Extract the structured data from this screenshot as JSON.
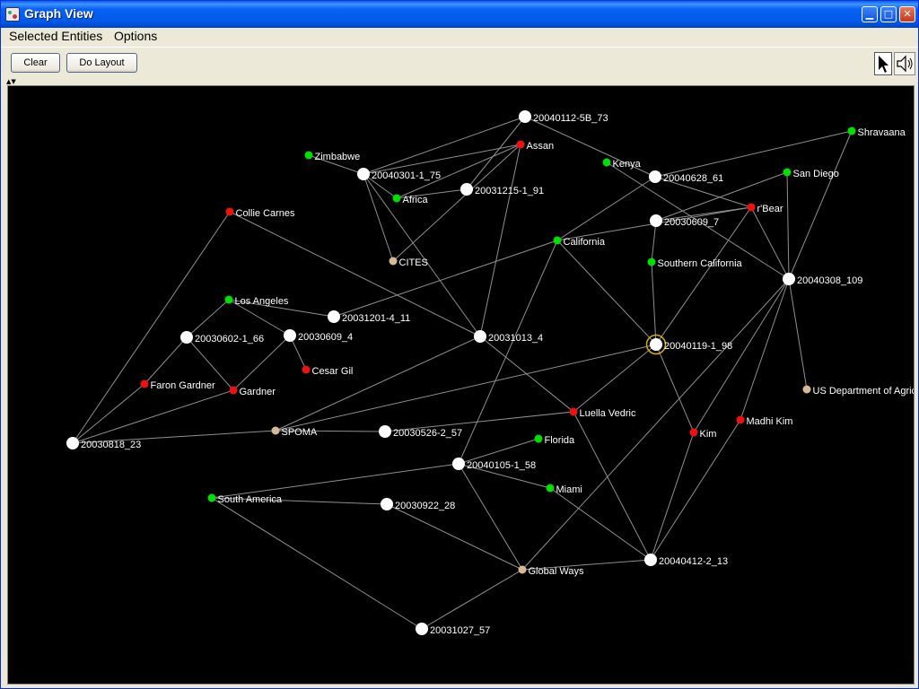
{
  "window": {
    "title": "Graph View"
  },
  "menu": {
    "items": [
      "Selected Entities",
      "Options"
    ]
  },
  "toolbar": {
    "clear_label": "Clear",
    "layout_label": "Do Layout"
  },
  "colors": {
    "event": "#ffffff",
    "place": "#00e000",
    "person": "#ee1111",
    "organization": "#d8b896",
    "edge": "#8f8f8f",
    "selection": "#d4b000"
  },
  "graph": {
    "nodes": [
      {
        "id": "n1",
        "label": "20040112-5B_73",
        "kind": "event"
      },
      {
        "id": "n2",
        "label": "Assan",
        "kind": "person"
      },
      {
        "id": "n3",
        "label": "Kenya",
        "kind": "place"
      },
      {
        "id": "n4",
        "label": "Shravaana",
        "kind": "place"
      },
      {
        "id": "n5",
        "label": "Zimbabwe",
        "kind": "place"
      },
      {
        "id": "n6",
        "label": "20040301-1_75",
        "kind": "event"
      },
      {
        "id": "n7",
        "label": "Africa",
        "kind": "place"
      },
      {
        "id": "n8",
        "label": "20031215-1_91",
        "kind": "event"
      },
      {
        "id": "n9",
        "label": "20040628_61",
        "kind": "event"
      },
      {
        "id": "n10",
        "label": "San Diego",
        "kind": "place"
      },
      {
        "id": "n11",
        "label": "Collie Carnes",
        "kind": "person"
      },
      {
        "id": "n12",
        "label": "r'Bear",
        "kind": "person"
      },
      {
        "id": "n13",
        "label": "20030609_7",
        "kind": "event"
      },
      {
        "id": "n14",
        "label": "California",
        "kind": "place"
      },
      {
        "id": "n15",
        "label": "CITES",
        "kind": "organization"
      },
      {
        "id": "n16",
        "label": "Southern California",
        "kind": "place"
      },
      {
        "id": "n17",
        "label": "20040308_109",
        "kind": "event"
      },
      {
        "id": "n18",
        "label": "Los Angeles",
        "kind": "place"
      },
      {
        "id": "n19",
        "label": "20031201-4_11",
        "kind": "event"
      },
      {
        "id": "n20",
        "label": "20030602-1_66",
        "kind": "event"
      },
      {
        "id": "n21",
        "label": "20030609_4",
        "kind": "event"
      },
      {
        "id": "n22",
        "label": "20031013_4",
        "kind": "event"
      },
      {
        "id": "n23",
        "label": "20040119-1_98",
        "kind": "event",
        "selected": true
      },
      {
        "id": "n24",
        "label": "Cesar Gil",
        "kind": "person"
      },
      {
        "id": "n25",
        "label": "Faron Gardner",
        "kind": "person"
      },
      {
        "id": "n26",
        "label": "Gardner",
        "kind": "person"
      },
      {
        "id": "n27",
        "label": "US Department of Agric",
        "kind": "organization"
      },
      {
        "id": "n28",
        "label": "Luella Vedric",
        "kind": "person"
      },
      {
        "id": "n29",
        "label": "Madhi Kim",
        "kind": "person"
      },
      {
        "id": "n30",
        "label": "Kim",
        "kind": "person"
      },
      {
        "id": "n31",
        "label": "20030818_23",
        "kind": "event"
      },
      {
        "id": "n32",
        "label": "SPOMA",
        "kind": "organization"
      },
      {
        "id": "n33",
        "label": "20030526-2_57",
        "kind": "event"
      },
      {
        "id": "n34",
        "label": "Florida",
        "kind": "place"
      },
      {
        "id": "n35",
        "label": "20040105-1_58",
        "kind": "event"
      },
      {
        "id": "n36",
        "label": "Miami",
        "kind": "place"
      },
      {
        "id": "n37",
        "label": "South America",
        "kind": "place"
      },
      {
        "id": "n38",
        "label": "20030922_28",
        "kind": "event"
      },
      {
        "id": "n39",
        "label": "Global Ways",
        "kind": "organization"
      },
      {
        "id": "n40",
        "label": "20040412-2_13",
        "kind": "event"
      },
      {
        "id": "n41",
        "label": "20031027_57",
        "kind": "event"
      }
    ],
    "edges": [
      [
        "n1",
        "n6"
      ],
      [
        "n1",
        "n8"
      ],
      [
        "n1",
        "n9"
      ],
      [
        "n2",
        "n6"
      ],
      [
        "n2",
        "n7"
      ],
      [
        "n2",
        "n22"
      ],
      [
        "n2",
        "n15"
      ],
      [
        "n3",
        "n17"
      ],
      [
        "n4",
        "n9"
      ],
      [
        "n4",
        "n17"
      ],
      [
        "n5",
        "n6"
      ],
      [
        "n6",
        "n7"
      ],
      [
        "n6",
        "n15"
      ],
      [
        "n6",
        "n22"
      ],
      [
        "n7",
        "n8"
      ],
      [
        "n9",
        "n12"
      ],
      [
        "n10",
        "n13"
      ],
      [
        "n10",
        "n17"
      ],
      [
        "n11",
        "n22"
      ],
      [
        "n11",
        "n31"
      ],
      [
        "n12",
        "n13"
      ],
      [
        "n12",
        "n14"
      ],
      [
        "n12",
        "n17"
      ],
      [
        "n12",
        "n23"
      ],
      [
        "n13",
        "n16"
      ],
      [
        "n14",
        "n19"
      ],
      [
        "n14",
        "n23"
      ],
      [
        "n14",
        "n9"
      ],
      [
        "n14",
        "n35"
      ],
      [
        "n16",
        "n23"
      ],
      [
        "n17",
        "n27"
      ],
      [
        "n17",
        "n30"
      ],
      [
        "n17",
        "n29"
      ],
      [
        "n17",
        "n39"
      ],
      [
        "n18",
        "n19"
      ],
      [
        "n18",
        "n20"
      ],
      [
        "n18",
        "n21"
      ],
      [
        "n20",
        "n26"
      ],
      [
        "n20",
        "n25"
      ],
      [
        "n21",
        "n24"
      ],
      [
        "n21",
        "n26"
      ],
      [
        "n22",
        "n28"
      ],
      [
        "n22",
        "n32"
      ],
      [
        "n23",
        "n28"
      ],
      [
        "n23",
        "n32"
      ],
      [
        "n23",
        "n30"
      ],
      [
        "n25",
        "n31"
      ],
      [
        "n26",
        "n31"
      ],
      [
        "n28",
        "n33"
      ],
      [
        "n28",
        "n40"
      ],
      [
        "n29",
        "n40"
      ],
      [
        "n30",
        "n40"
      ],
      [
        "n31",
        "n32"
      ],
      [
        "n32",
        "n33"
      ],
      [
        "n34",
        "n35"
      ],
      [
        "n35",
        "n36"
      ],
      [
        "n35",
        "n37"
      ],
      [
        "n35",
        "n39"
      ],
      [
        "n36",
        "n40"
      ],
      [
        "n37",
        "n38"
      ],
      [
        "n37",
        "n41"
      ],
      [
        "n38",
        "n39"
      ],
      [
        "n39",
        "n40"
      ],
      [
        "n39",
        "n41"
      ]
    ]
  }
}
